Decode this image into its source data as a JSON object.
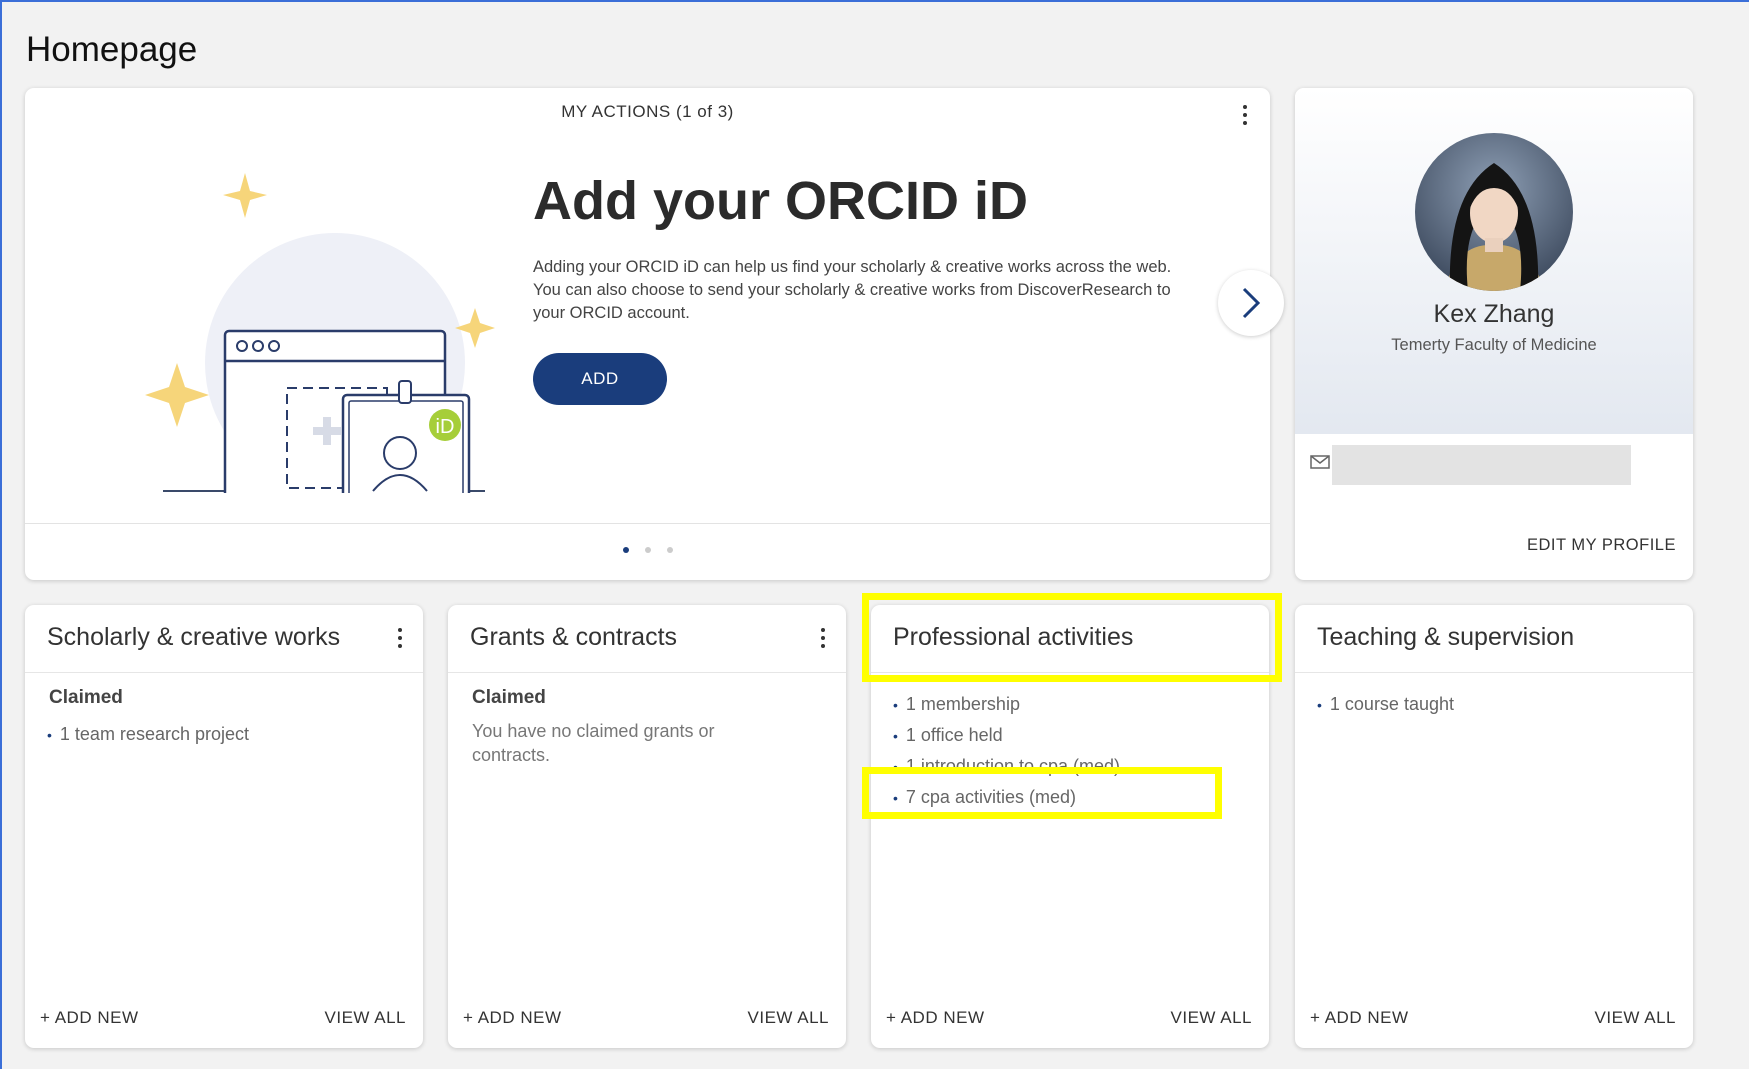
{
  "page": {
    "title": "Homepage"
  },
  "actions": {
    "header": "MY ACTIONS (1 of 3)",
    "title": "Add your ORCID iD",
    "description": "Adding your ORCID iD can help us find your scholarly & creative works across the web. You can also choose to send your scholarly & creative works from DiscoverResearch to your ORCID account.",
    "add_label": "ADD",
    "orcid_badge": "iD",
    "pager": {
      "current": 1,
      "total": 3
    }
  },
  "profile": {
    "name": "Kex Zhang",
    "department": "Temerty Faculty of Medicine",
    "email": "",
    "edit_label": "EDIT MY PROFILE"
  },
  "cards": {
    "works": {
      "title": "Scholarly & creative works",
      "claimed_label": "Claimed",
      "items": [
        "1 team research project"
      ],
      "add_label": "+ ADD NEW",
      "view_label": "VIEW ALL"
    },
    "grants": {
      "title": "Grants & contracts",
      "claimed_label": "Claimed",
      "empty_message": "You have no claimed grants or contracts.",
      "add_label": "+ ADD NEW",
      "view_label": "VIEW ALL"
    },
    "professional": {
      "title": "Professional activities",
      "items": [
        "1 membership",
        "1 office held",
        "1 introduction to cpa (med)",
        "7 cpa activities (med)"
      ],
      "add_label": "+ ADD NEW",
      "view_label": "VIEW ALL"
    },
    "teaching": {
      "title": "Teaching & supervision",
      "items": [
        "1 course taught"
      ],
      "add_label": "+ ADD NEW",
      "view_label": "VIEW ALL"
    }
  },
  "colors": {
    "accent": "#1a3d7c",
    "highlight": "#ffff00",
    "star": "#f6d57a",
    "orcid_green": "#a6ce39"
  }
}
